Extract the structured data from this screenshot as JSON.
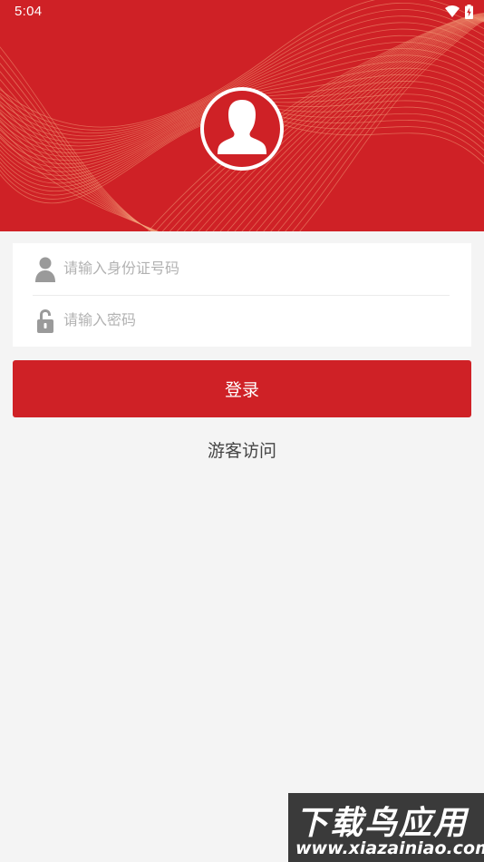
{
  "status_bar": {
    "time": "5:04",
    "icons": [
      "wifi-icon",
      "battery-charging-icon"
    ]
  },
  "header": {
    "background_color": "#cf2126",
    "avatar_icon": "user-avatar-icon"
  },
  "login_form": {
    "id_field": {
      "placeholder": "请输入身份证号码",
      "value": "",
      "icon": "user-icon"
    },
    "password_field": {
      "placeholder": "请输入密码",
      "value": "",
      "icon": "lock-icon"
    },
    "login_button_label": "登录",
    "guest_link_label": "游客访问"
  },
  "watermark": {
    "title": "下载鸟应用",
    "url": "www.xiazainiao.com"
  },
  "colors": {
    "primary": "#cf2126",
    "background": "#f4f4f4",
    "placeholder": "#b2b2b2"
  }
}
